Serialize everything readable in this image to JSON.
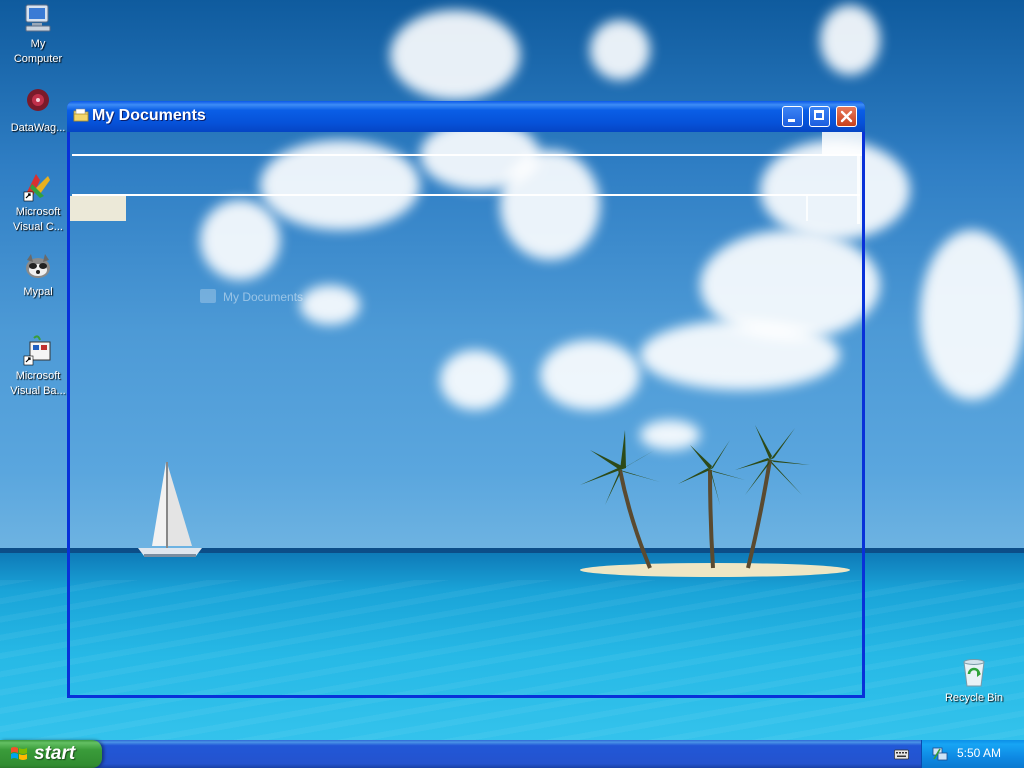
{
  "desktop": {
    "icons": [
      {
        "name": "my-computer",
        "label_line1": "My",
        "label_line2": "Computer"
      },
      {
        "name": "datawag",
        "label_line1": "DataWag...",
        "label_line2": ""
      },
      {
        "name": "microsoft-visual-c",
        "label_line1": "Microsoft",
        "label_line2": "Visual C..."
      },
      {
        "name": "mypal",
        "label_line1": "Mypal",
        "label_line2": ""
      },
      {
        "name": "microsoft-visual-basic",
        "label_line1": "Microsoft",
        "label_line2": "Visual Ba..."
      },
      {
        "name": "recycle-bin",
        "label_line1": "Recycle Bin",
        "label_line2": ""
      }
    ]
  },
  "window": {
    "title": "My Documents",
    "ghost_label": "My Documents",
    "icon": "folder-icon"
  },
  "taskbar": {
    "start_label": "start",
    "clock": "5:50 AM"
  },
  "colors": {
    "title_bar": "#0652d9",
    "window_border": "#0831d9",
    "start_green": "#3a9c3a",
    "tray_blue": "#0e8ae4",
    "close_red": "#c8401c"
  }
}
